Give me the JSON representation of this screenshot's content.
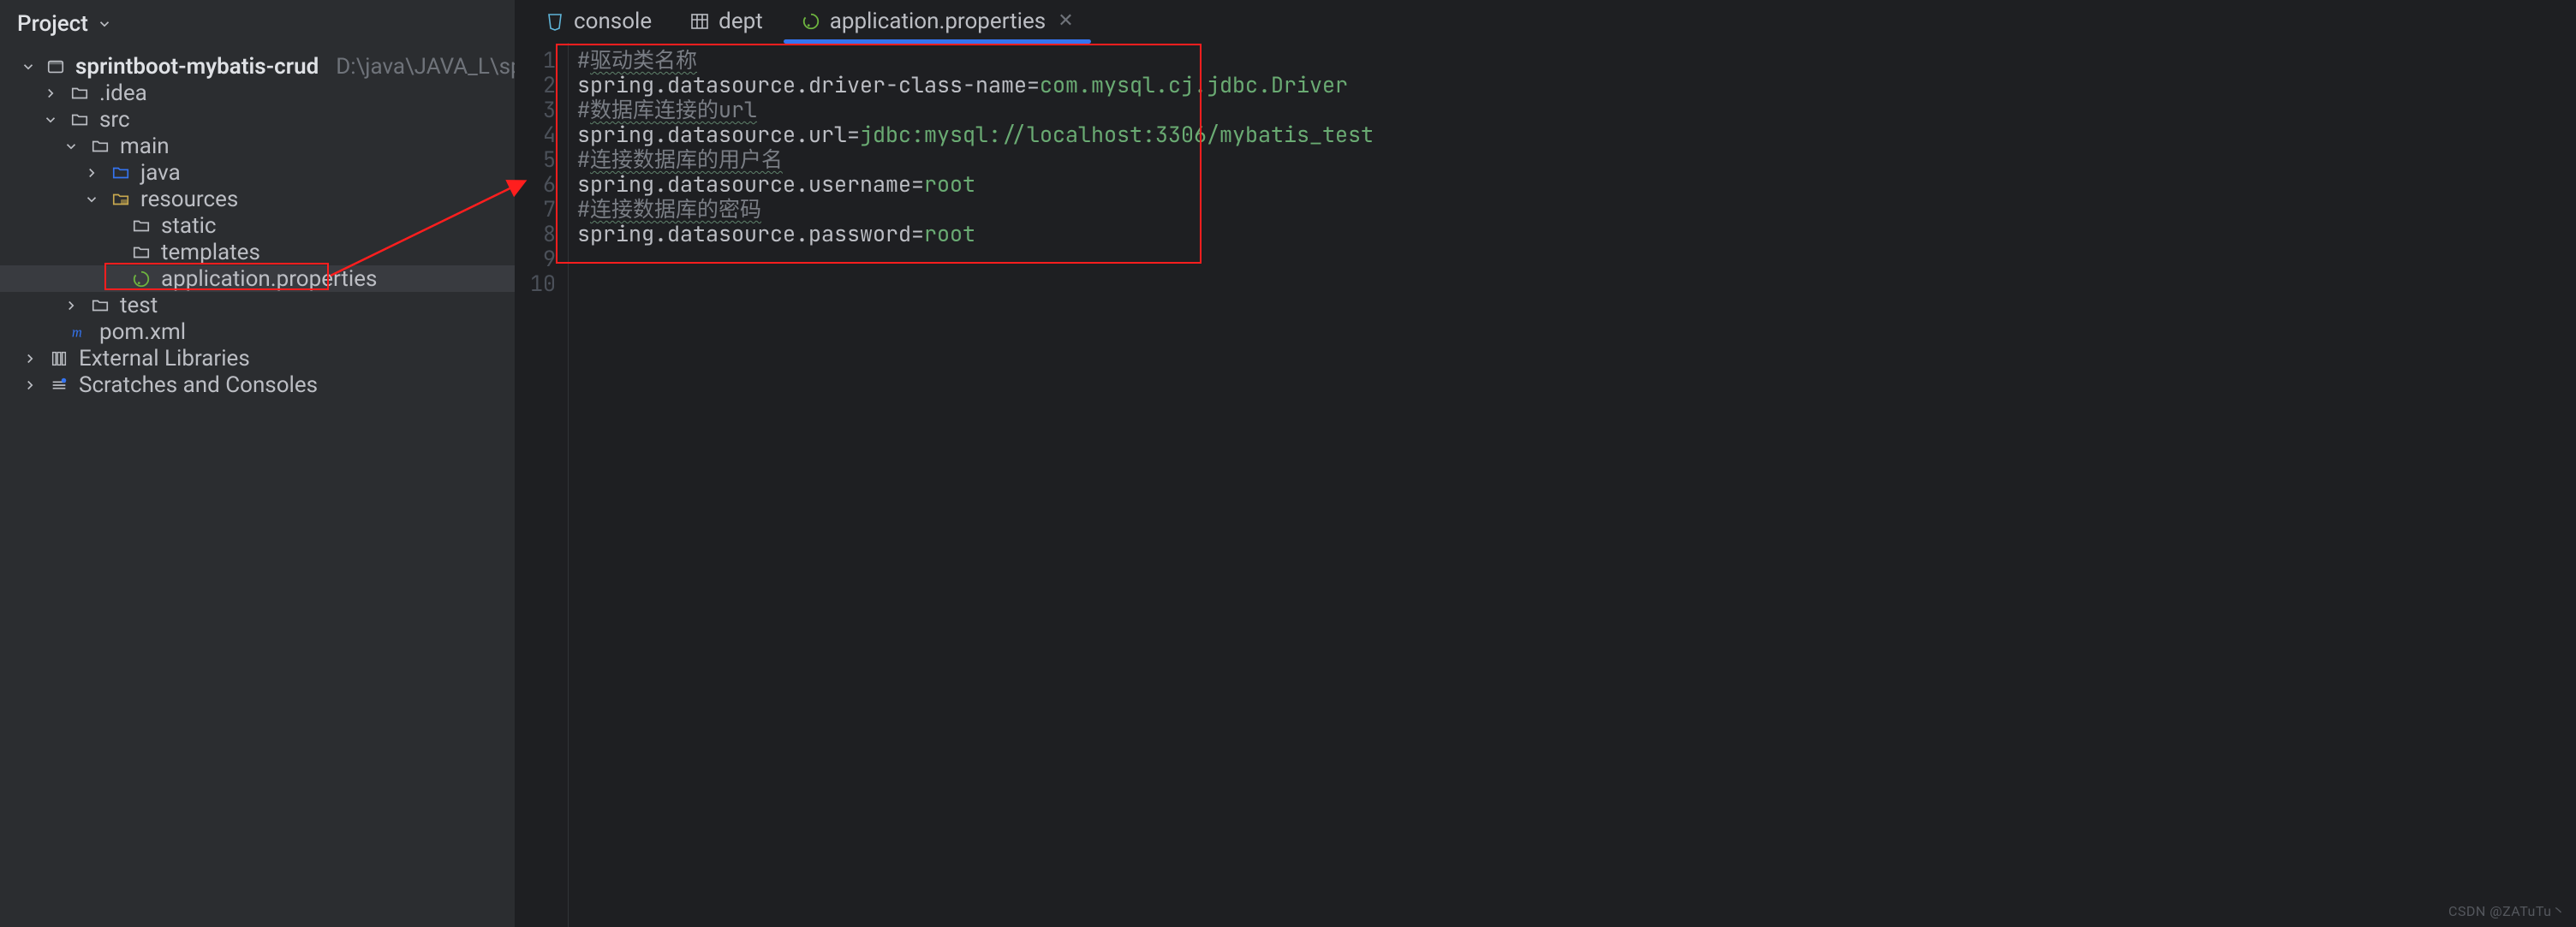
{
  "sidebar": {
    "title": "Project",
    "root": {
      "name": "sprintboot-mybatis-crud",
      "path": "D:\\java\\JAVA_L\\sprintboot-mybatis-cru"
    },
    "items": {
      "idea": ".idea",
      "src": "src",
      "main": "main",
      "java": "java",
      "resources": "resources",
      "static": "static",
      "templates": "templates",
      "appprops": "application.properties",
      "test": "test",
      "pom": "pom.xml",
      "extlib": "External Libraries",
      "scratches": "Scratches and Consoles"
    }
  },
  "tabs": {
    "console": "console",
    "dept": "dept",
    "appprops": "application.properties"
  },
  "code": {
    "lines": {
      "1": {
        "comment_hash": "#",
        "comment_cn": "驱动类名称"
      },
      "2": {
        "key": "spring.datasource.driver-class-name",
        "eq": "=",
        "val": "com.mysql.cj.jdbc.Driver"
      },
      "3": {
        "comment_hash": "#",
        "comment_cn": "数据库连接的url"
      },
      "4": {
        "key": "spring.datasource.url",
        "eq": "=",
        "val": "jdbc:mysql://localhost:3306/mybatis_test"
      },
      "5": {
        "comment_hash": "#",
        "comment_cn": "连接数据库的用户名"
      },
      "6": {
        "key": "spring.datasource.username",
        "eq": "=",
        "val": "root"
      },
      "7": {
        "comment_hash": "#",
        "comment_cn": "连接数据库的密码"
      },
      "8": {
        "key": "spring.datasource.password",
        "eq": "=",
        "val": "root"
      }
    },
    "gutter": [
      "1",
      "2",
      "3",
      "4",
      "5",
      "6",
      "7",
      "8",
      "9",
      "10"
    ]
  },
  "watermark": "CSDN @ZATuTu丶"
}
